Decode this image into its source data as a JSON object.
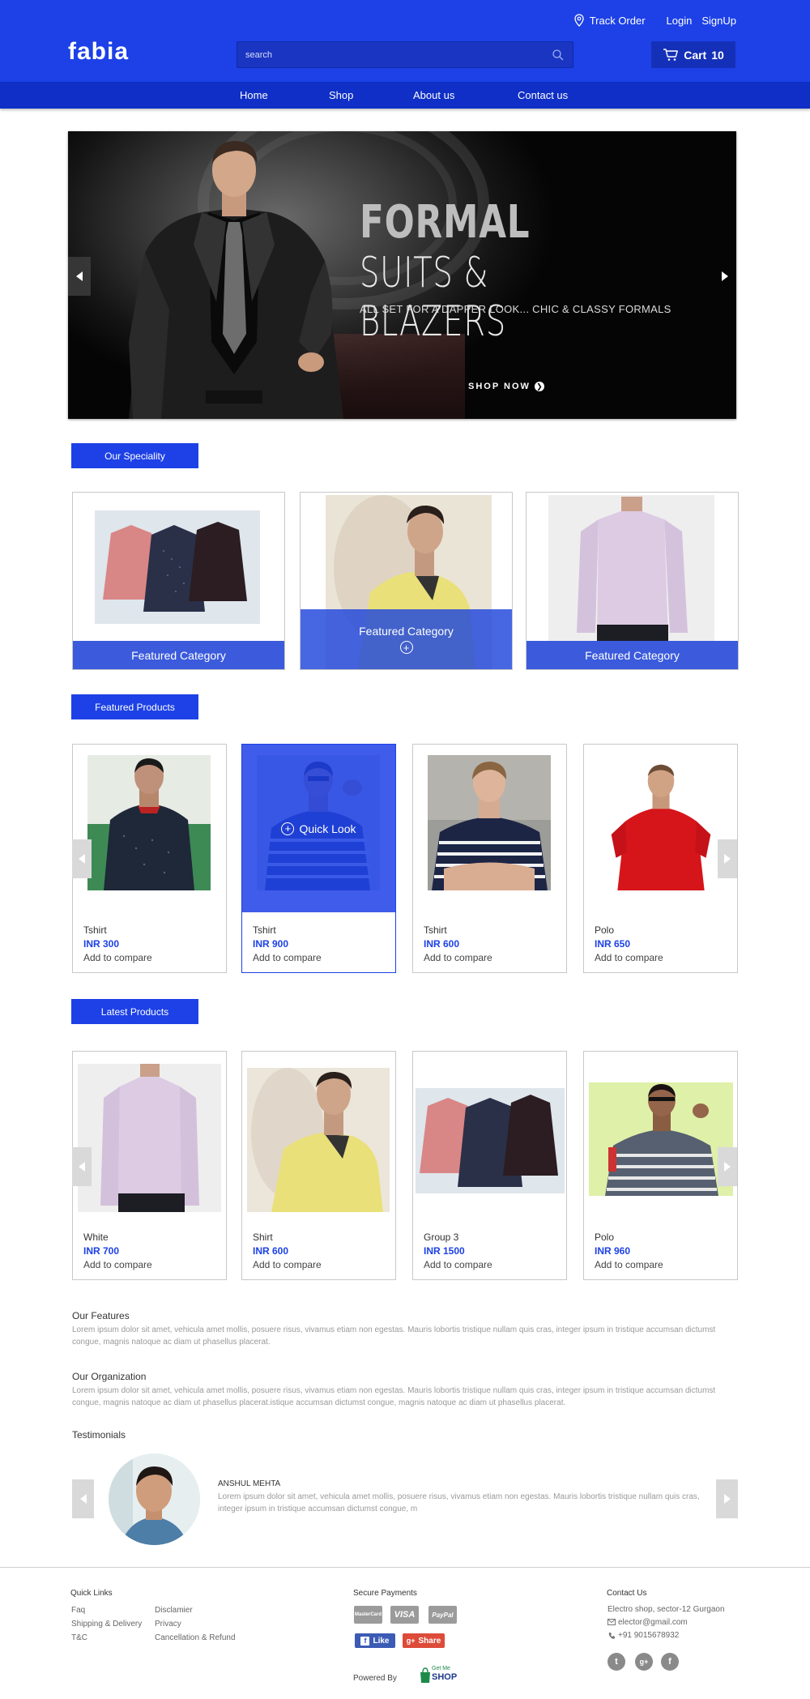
{
  "brand": {
    "logo": "fabia",
    "accent": "#1d41e6"
  },
  "header": {
    "track_order": "Track Order",
    "login": "Login",
    "signup": "SignUp",
    "search_placeholder": "search",
    "cart_label": "Cart",
    "cart_count": "10"
  },
  "nav": {
    "items": [
      "Home",
      "Shop",
      "About us",
      "Contact us"
    ]
  },
  "hero": {
    "title_line1": "FORMAL",
    "title_line2": "SUITS & BLAZERS",
    "subtitle": "ALL SET FOR A DAPPER LOOK... CHIC & CLASSY FORMALS",
    "cta": "SHOP NOW"
  },
  "speciality": {
    "title": "Our Speciality",
    "cards": [
      {
        "label": "Featured Category"
      },
      {
        "label": "Featured Category"
      },
      {
        "label": "Featured Category"
      }
    ]
  },
  "featured": {
    "title": "Featured Products",
    "quick_look": "Quick Look",
    "products": [
      {
        "name": "Tshirt",
        "price": "INR 300",
        "compare": "Add to compare"
      },
      {
        "name": "Tshirt",
        "price": "INR 900",
        "compare": "Add to compare"
      },
      {
        "name": "Tshirt",
        "price": "INR 600",
        "compare": "Add to compare"
      },
      {
        "name": "Polo",
        "price": "INR 650",
        "compare": "Add to compare"
      }
    ]
  },
  "latest": {
    "title": "Latest Products",
    "products": [
      {
        "name": "White",
        "price": "INR 700",
        "compare": "Add to compare"
      },
      {
        "name": "Shirt",
        "price": "INR 600",
        "compare": "Add to compare"
      },
      {
        "name": "Group 3",
        "price": "INR 1500",
        "compare": "Add to compare"
      },
      {
        "name": "Polo",
        "price": "INR 960",
        "compare": "Add to compare"
      }
    ]
  },
  "features": {
    "title": "Our Features",
    "text": "Lorem ipsum dolor sit amet, vehicula amet mollis, posuere risus, vivamus etiam non egestas. Mauris lobortis tristique nullam quis cras, integer ipsum in tristique accumsan dictumst congue, magnis natoque ac diam ut phasellus placerat."
  },
  "organization": {
    "title": "Our Organization",
    "text": "Lorem ipsum dolor sit amet, vehicula amet mollis, posuere risus, vivamus etiam non egestas. Mauris lobortis tristique nullam quis cras, integer ipsum in tristique accumsan dictumst congue, magnis natoque ac diam ut phasellus placerat.istique accumsan dictumst congue, magnis natoque ac diam ut phasellus placerat."
  },
  "testimonials": {
    "title": "Testimonials",
    "name": "ANSHUL MEHTA",
    "text": "Lorem ipsum dolor sit amet, vehicula amet mollis, posuere risus, vivamus etiam non egestas. Mauris lobortis tristique nullam quis cras, integer ipsum in tristique accumsan dictumst congue, m"
  },
  "footer": {
    "quick_links_title": "Quick Links",
    "links_col1": [
      "Faq",
      "Shipping & Delivery",
      "T&C"
    ],
    "links_col2": [
      "Disclamier",
      "Privacy",
      "Cancellation & Refund"
    ],
    "secure_title": "Secure Payments",
    "payments": [
      "MasterCard",
      "VISA",
      "PayPal"
    ],
    "fb_like": "Like",
    "gplus_share": "Share",
    "powered_by": "Powered By",
    "powered_brand_small": "Get Me",
    "powered_brand": "SHOP",
    "contact_title": "Contact Us",
    "address": "Electro shop, sector-12 Gurgaon",
    "email": "elector@gmail.com",
    "phone": "+91 9015678932"
  }
}
